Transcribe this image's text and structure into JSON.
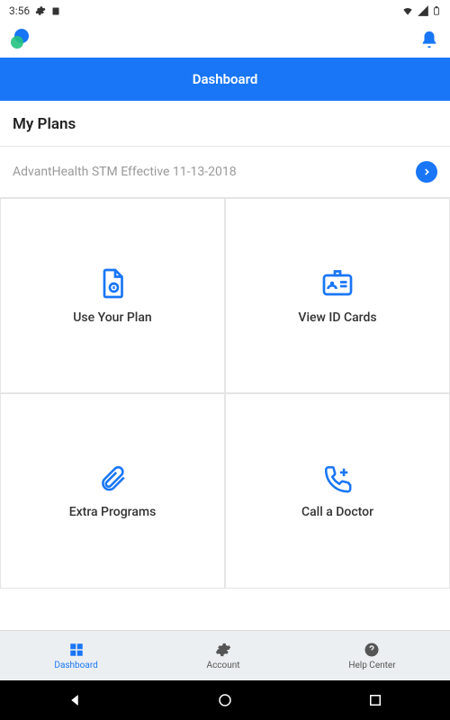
{
  "status": {
    "time": "3:56"
  },
  "header": {
    "title": "Dashboard"
  },
  "section": {
    "title": "My Plans"
  },
  "plan": {
    "name": "AdvantHealth STM Effective 11-13-2018"
  },
  "tiles": {
    "usePlan": "Use Your Plan",
    "viewCards": "View ID Cards",
    "extraPrograms": "Extra Programs",
    "callDoctor": "Call a Doctor"
  },
  "nav": {
    "dashboard": "Dashboard",
    "account": "Account",
    "help": "Help Center"
  }
}
